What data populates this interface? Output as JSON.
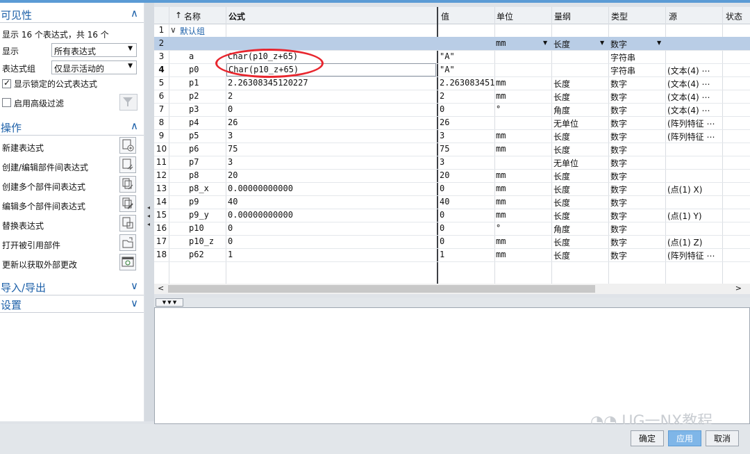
{
  "visibility": {
    "title": "可见性",
    "summary": "显示 16 个表达式，共 16 个",
    "display_label": "显示",
    "display_value": "所有表达式",
    "group_label": "表达式组",
    "group_value": "仅显示活动的",
    "show_locked_label": "显示锁定的公式表达式",
    "show_locked_checked": true,
    "advanced_filter_label": "启用高级过滤",
    "advanced_filter_checked": false
  },
  "operations": {
    "title": "操作",
    "items": [
      {
        "label": "新建表达式",
        "icon": "new-expression-icon"
      },
      {
        "label": "创建/编辑部件间表达式",
        "icon": "interpart-expression-icon"
      },
      {
        "label": "创建多个部件间表达式",
        "icon": "multi-interpart-icon"
      },
      {
        "label": "编辑多个部件间表达式",
        "icon": "edit-multi-interpart-icon"
      },
      {
        "label": "替换表达式",
        "icon": "replace-expression-icon"
      },
      {
        "label": "打开被引用部件",
        "icon": "open-referenced-part-icon"
      },
      {
        "label": "更新以获取外部更改",
        "icon": "update-external-icon"
      }
    ]
  },
  "import_export": {
    "title": "导入/导出"
  },
  "settings": {
    "title": "设置"
  },
  "table": {
    "columns": {
      "sort": "↑",
      "name": "名称",
      "formula": "公式",
      "value": "值",
      "unit": "单位",
      "dimension": "量纲",
      "type": "类型",
      "source": "源",
      "status": "状态"
    },
    "group_row": {
      "num": "1",
      "label": "默认组"
    },
    "new_row": {
      "num": "2",
      "unit": "mm",
      "dimension": "长度",
      "type": "数字"
    },
    "rows": [
      {
        "num": "3",
        "name": "a",
        "formula": "Char(p10_z+65)",
        "value": "\"A\"",
        "unit": "",
        "dimension": "",
        "type": "字符串",
        "source": ""
      },
      {
        "num": "4",
        "name": "p0",
        "formula": "Char(p10_z+65)",
        "value": "\"A\"",
        "unit": "",
        "dimension": "",
        "type": "字符串",
        "source": "(文本(4) ⋯"
      },
      {
        "num": "5",
        "name": "p1",
        "formula": "2.26308345120227",
        "value": "2.263083451",
        "unit": "mm",
        "dimension": "长度",
        "type": "数字",
        "source": "(文本(4) ⋯"
      },
      {
        "num": "6",
        "name": "p2",
        "formula": "2",
        "value": "2",
        "unit": "mm",
        "dimension": "长度",
        "type": "数字",
        "source": "(文本(4) ⋯"
      },
      {
        "num": "7",
        "name": "p3",
        "formula": "0",
        "value": "0",
        "unit": "°",
        "dimension": "角度",
        "type": "数字",
        "source": "(文本(4) ⋯"
      },
      {
        "num": "8",
        "name": "p4",
        "formula": "26",
        "value": "26",
        "unit": "",
        "dimension": "无单位",
        "type": "数字",
        "source": "(阵列特征 ⋯"
      },
      {
        "num": "9",
        "name": "p5",
        "formula": "3",
        "value": "3",
        "unit": "mm",
        "dimension": "长度",
        "type": "数字",
        "source": "(阵列特征 ⋯"
      },
      {
        "num": "10",
        "name": "p6",
        "formula": "75",
        "value": "75",
        "unit": "mm",
        "dimension": "长度",
        "type": "数字",
        "source": ""
      },
      {
        "num": "11",
        "name": "p7",
        "formula": "3",
        "value": "3",
        "unit": "",
        "dimension": "无单位",
        "type": "数字",
        "source": ""
      },
      {
        "num": "12",
        "name": "p8",
        "formula": "20",
        "value": "20",
        "unit": "mm",
        "dimension": "长度",
        "type": "数字",
        "source": ""
      },
      {
        "num": "13",
        "name": "p8_x",
        "formula": "0.00000000000",
        "value": "0",
        "unit": "mm",
        "dimension": "长度",
        "type": "数字",
        "source": "(点(1) X)"
      },
      {
        "num": "14",
        "name": "p9",
        "formula": "40",
        "value": "40",
        "unit": "mm",
        "dimension": "长度",
        "type": "数字",
        "source": ""
      },
      {
        "num": "15",
        "name": "p9_y",
        "formula": "0.00000000000",
        "value": "0",
        "unit": "mm",
        "dimension": "长度",
        "type": "数字",
        "source": "(点(1) Y)"
      },
      {
        "num": "16",
        "name": "p10",
        "formula": "0",
        "value": "0",
        "unit": "°",
        "dimension": "角度",
        "type": "数字",
        "source": ""
      },
      {
        "num": "17",
        "name": "p10_z",
        "formula": "0",
        "value": "0",
        "unit": "mm",
        "dimension": "长度",
        "type": "数字",
        "source": "(点(1) Z)"
      },
      {
        "num": "18",
        "name": "p62",
        "formula": "1",
        "value": "1",
        "unit": "mm",
        "dimension": "长度",
        "type": "数字",
        "source": "(阵列特征 ⋯"
      }
    ]
  },
  "buttons": {
    "ok": "确定",
    "apply": "应用",
    "cancel": "取消"
  },
  "watermark": "UG一NX教程",
  "colors": {
    "accent": "#1b5fa8",
    "selection": "#b9cde6",
    "highlight_oval": "#e8262e",
    "apply_button": "#7fb6e8"
  }
}
